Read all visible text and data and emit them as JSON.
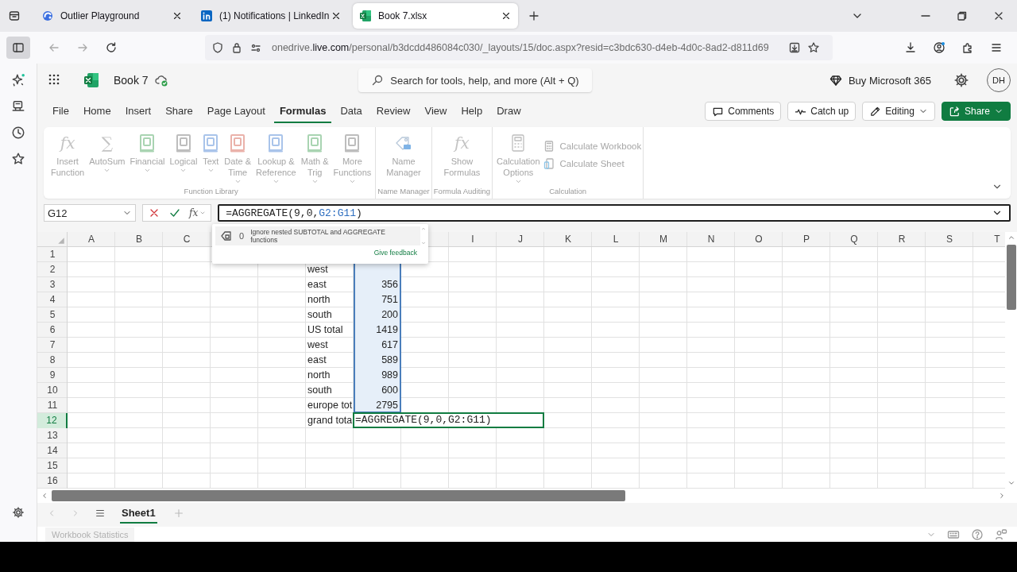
{
  "browser": {
    "tabs": [
      {
        "title": "Outlier Playground",
        "kind": "swirl",
        "selected": false
      },
      {
        "title": "(1) Notifications | LinkedIn",
        "kind": "square",
        "selected": false
      },
      {
        "title": "Book 7.xlsx",
        "kind": "sheet",
        "selected": true
      }
    ],
    "url": [
      {
        "text": "onedrive."
      },
      {
        "text": "live.com",
        "kind": "domain"
      },
      {
        "text": "/personal/b3dcdd486084c030/_layouts/15/doc.aspx?resid=c3bdc630-d4eb-4d0c-8ad2-d811d69"
      }
    ]
  },
  "app": {
    "document_title": "Book 7",
    "search": {
      "placeholder": "Search for tools, help, and more (Alt + Q)"
    },
    "buy_link": "Buy Microsoft 365",
    "avatar": "DH"
  },
  "menu_tabs": [
    {
      "label": "File",
      "selected": false
    },
    {
      "label": "Home",
      "selected": false
    },
    {
      "label": "Insert",
      "selected": false
    },
    {
      "label": "Share",
      "selected": false
    },
    {
      "label": "Page Layout",
      "selected": false
    },
    {
      "label": "Formulas",
      "selected": true
    },
    {
      "label": "Data",
      "selected": false
    },
    {
      "label": "Review",
      "selected": false
    },
    {
      "label": "View",
      "selected": false
    },
    {
      "label": "Help",
      "selected": false
    },
    {
      "label": "Draw",
      "selected": false
    }
  ],
  "header_buttons": [
    {
      "label": "Comments",
      "kind": "comment"
    },
    {
      "label": "Catch up",
      "kind": "pulse"
    },
    {
      "label": "Editing",
      "kind": "pencil"
    },
    {
      "label": "Share",
      "kind": "share"
    }
  ],
  "ribbon": {
    "groups": [
      {
        "label": "Function Library",
        "items": [
          {
            "label": "Insert\nFunction",
            "kind": "symbol",
            "symbol": "fx",
            "dropdown": false,
            "disabled": true
          },
          {
            "label": "AutoSum",
            "kind": "symbol",
            "symbol": "∑",
            "dropdown": true,
            "disabled": true
          },
          {
            "label": "Financial",
            "kind": "book",
            "color": "#a9d4b2",
            "dropdown": true,
            "disabled": true
          },
          {
            "label": "Logical",
            "kind": "book",
            "color": "#bdbdbd",
            "dropdown": true,
            "disabled": true
          },
          {
            "label": "Text",
            "kind": "book",
            "color": "#a9c4ea",
            "dropdown": true,
            "disabled": true
          },
          {
            "label": "Date &\nTime",
            "kind": "book",
            "color": "#eab2aa",
            "dropdown": true,
            "disabled": true
          },
          {
            "label": "Lookup &\nReference",
            "kind": "book",
            "color": "#a9c4ea",
            "dropdown": true,
            "disabled": true
          },
          {
            "label": "Math &\nTrig",
            "kind": "book",
            "color": "#a9d4b2",
            "dropdown": true,
            "disabled": true
          },
          {
            "label": "More\nFunctions",
            "kind": "book",
            "color": "#bdbdbd",
            "dropdown": true,
            "disabled": true
          }
        ]
      },
      {
        "label": "Name Manager",
        "items": [
          {
            "label": "Name\nManager",
            "kind": "tag",
            "dropdown": false,
            "disabled": true
          }
        ]
      },
      {
        "label": "Formula Auditing",
        "items": [
          {
            "label": "Show\nFormulas",
            "kind": "symbol",
            "symbol": "fx",
            "dropdown": false,
            "disabled": true
          }
        ]
      },
      {
        "label": "Calculation",
        "items": [
          {
            "label": "Calculation\nOptions",
            "kind": "calculator",
            "dropdown": true,
            "disabled": true
          },
          {
            "label": "Calculate Workbook",
            "kind": "small",
            "disabled": true
          },
          {
            "label": "Calculate Sheet",
            "kind": "small",
            "disabled": true
          }
        ]
      }
    ]
  },
  "formula_bar": {
    "name_box": "G12",
    "function_symbol": "fx",
    "formula": [
      {
        "text": "=AGGREGATE(9,0,"
      },
      {
        "text": "G2:G11",
        "kind": "reference"
      },
      {
        "text": ")"
      }
    ]
  },
  "autocomplete": {
    "number": "0",
    "description": "Ignore nested SUBTOTAL and AGGREGATE functions",
    "link": "Give feedback"
  },
  "grid": {
    "columns_left": [
      "A",
      "B",
      "C"
    ],
    "columns_right": [
      "I",
      "J",
      "K",
      "L",
      "M",
      "N",
      "O",
      "P",
      "Q",
      "R",
      "S",
      "T"
    ],
    "rows": [
      {
        "number": "1",
        "selected": false
      },
      {
        "number": "2",
        "selected": false,
        "label": "west",
        "in_range": true
      },
      {
        "number": "3",
        "selected": false,
        "label": "east",
        "value": "356",
        "in_range": true
      },
      {
        "number": "4",
        "selected": false,
        "label": "north",
        "value": "751",
        "in_range": true
      },
      {
        "number": "5",
        "selected": false,
        "label": "south",
        "value": "200",
        "in_range": true
      },
      {
        "number": "6",
        "selected": false,
        "label": "US total",
        "value": "1419",
        "in_range": true
      },
      {
        "number": "7",
        "selected": false,
        "label": "west",
        "value": "617",
        "in_range": true
      },
      {
        "number": "8",
        "selected": false,
        "label": "east",
        "value": "589",
        "in_range": true
      },
      {
        "number": "9",
        "selected": false,
        "label": "north",
        "value": "989",
        "in_range": true
      },
      {
        "number": "10",
        "selected": false,
        "label": "south",
        "value": "600",
        "in_range": true
      },
      {
        "number": "11",
        "selected": false,
        "label": "europe tot",
        "value": "2795",
        "in_range": true
      },
      {
        "number": "12",
        "selected": true,
        "label": "grand tota",
        "editing": "=AGGREGATE(9,0,G2:G11)"
      },
      {
        "number": "13",
        "selected": false
      },
      {
        "number": "14",
        "selected": false
      },
      {
        "number": "15",
        "selected": false
      },
      {
        "number": "16",
        "selected": false
      }
    ]
  },
  "sheet_tabs": [
    {
      "label": "Sheet1",
      "selected": true
    }
  ],
  "status_bar": {
    "statistics_button": "Workbook Statistics"
  }
}
